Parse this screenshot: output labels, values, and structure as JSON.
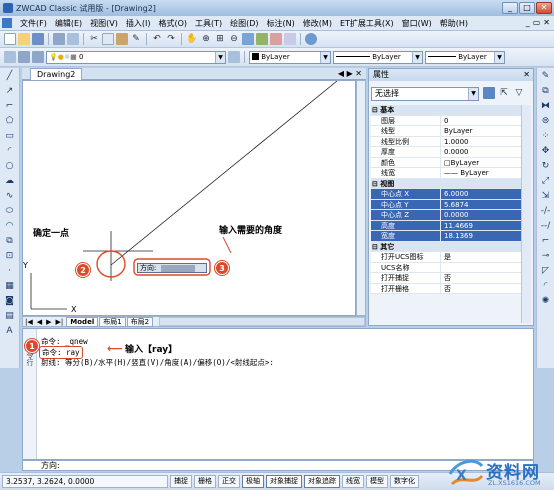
{
  "window": {
    "title": "ZWCAD Classic 试用版 - [Drawing2]",
    "min": "_",
    "max": "□",
    "close": "✕"
  },
  "menus": [
    "文件(F)",
    "编辑(E)",
    "视图(V)",
    "插入(I)",
    "格式(O)",
    "工具(T)",
    "绘图(D)",
    "标注(N)",
    "修改(M)",
    "ET扩展工具(X)",
    "窗口(W)",
    "帮助(H)"
  ],
  "mdi": {
    "min": "_",
    "restore": "▭",
    "close": "✕"
  },
  "toolbar2": {
    "layer_value": "0",
    "color_value": "ByLayer",
    "linetype_value": "ByLayer",
    "lineweight_value": "ByLayer"
  },
  "doc_tab": {
    "name": "Drawing2",
    "ctrls": "◀ ▶ ✕"
  },
  "layout_tabs": [
    "Model",
    "布局1",
    "布局2"
  ],
  "canvas": {
    "axis_x": "X",
    "axis_y": "Y",
    "dir_label": "方向:",
    "anno_point": "确定一点",
    "anno_angle": "输入需要的角度",
    "badge2": "2",
    "badge3": "3"
  },
  "properties": {
    "title": "属性",
    "close": "✕",
    "selection": "无选择",
    "rows": [
      {
        "cat": true,
        "k": "⊟ 基本"
      },
      {
        "k": "图层",
        "v": "0"
      },
      {
        "k": "线型",
        "v": "ByLayer"
      },
      {
        "k": "线型比例",
        "v": "1.0000"
      },
      {
        "k": "厚度",
        "v": "0.0000"
      },
      {
        "k": "颜色",
        "v": "□ByLayer"
      },
      {
        "k": "线宽",
        "v": "—— ByLayer"
      },
      {
        "cat": true,
        "k": "⊟ 视图"
      },
      {
        "hl": true,
        "k": "中心点 X",
        "v": "6.0000"
      },
      {
        "hl": true,
        "k": "中心点 Y",
        "v": "5.6874"
      },
      {
        "hl": true,
        "k": "中心点 Z",
        "v": "0.0000"
      },
      {
        "hl": true,
        "k": "高度",
        "v": "11.4669"
      },
      {
        "hl": true,
        "k": "宽度",
        "v": "18.1369"
      },
      {
        "cat": true,
        "k": "⊟ 其它"
      },
      {
        "k": "打开UCS图标",
        "v": "是"
      },
      {
        "k": "UCS名称",
        "v": ""
      },
      {
        "k": "打开捕捉",
        "v": "否"
      },
      {
        "k": "打开栅格",
        "v": "否"
      }
    ]
  },
  "command": {
    "line1": "命令: _qnew",
    "line2": "命令: ray",
    "line3": "射线: 等分(B)/水平(H)/竖直(V)/角度(A)/偏移(O)/<射线起点>:",
    "anno_ray": "输入【ray】",
    "badge1": "1",
    "side": "命令行",
    "prompt": "方向:"
  },
  "status": {
    "coords": "3.2537,  3.2624,  0.0000",
    "buttons": [
      "捕捉",
      "栅格",
      "正交",
      "极轴",
      "对象捕捉",
      "对象追踪",
      "线宽",
      "模型",
      "数字化"
    ]
  },
  "watermark": {
    "text": "资料网",
    "url": "ZL.XS1616.COM"
  }
}
